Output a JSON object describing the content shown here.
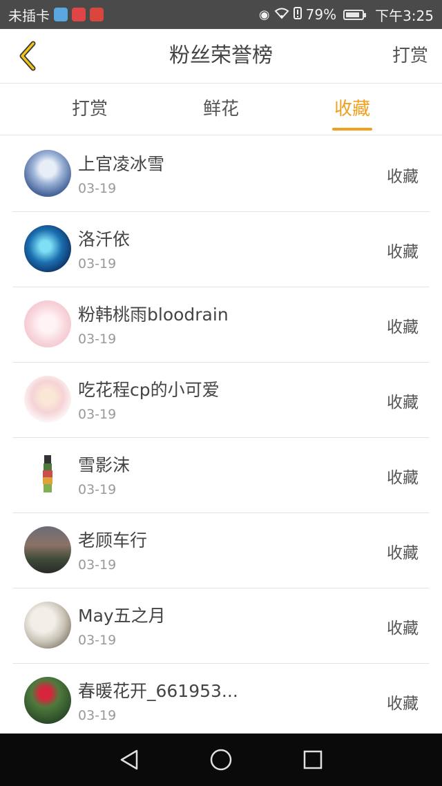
{
  "status_bar": {
    "carrier": "未插卡",
    "battery": "79%",
    "time": "下午3:25",
    "battery_level": 0.79
  },
  "header": {
    "title": "粉丝荣誉榜",
    "right_action": "打赏"
  },
  "tabs": [
    {
      "label": "打赏",
      "active": false
    },
    {
      "label": "鲜花",
      "active": false
    },
    {
      "label": "收藏",
      "active": true
    }
  ],
  "fans": [
    {
      "name": "上官凌冰雪",
      "date": "03-19",
      "action": "收藏"
    },
    {
      "name": "洛汘依",
      "date": "03-19",
      "action": "收藏"
    },
    {
      "name": "粉韩桃雨bloodrain",
      "date": "03-19",
      "action": "收藏"
    },
    {
      "name": "吃花程cp的小可爱",
      "date": "03-19",
      "action": "收藏"
    },
    {
      "name": "雪影沫",
      "date": "03-19",
      "action": "收藏"
    },
    {
      "name": "老顾车行",
      "date": "03-19",
      "action": "收藏"
    },
    {
      "name": "May五之月",
      "date": "03-19",
      "action": "收藏"
    },
    {
      "name": "春暖花开_661953...",
      "date": "03-19",
      "action": "收藏"
    }
  ],
  "colors": {
    "accent": "#f0a01e",
    "status_bar_bg": "#4a4a4a",
    "nav_bar_bg": "#0a0a0a"
  },
  "icons": {
    "back": "chevron-left-icon",
    "nav_back": "triangle-back-icon",
    "nav_home": "circle-home-icon",
    "nav_recent": "square-recent-icon"
  }
}
